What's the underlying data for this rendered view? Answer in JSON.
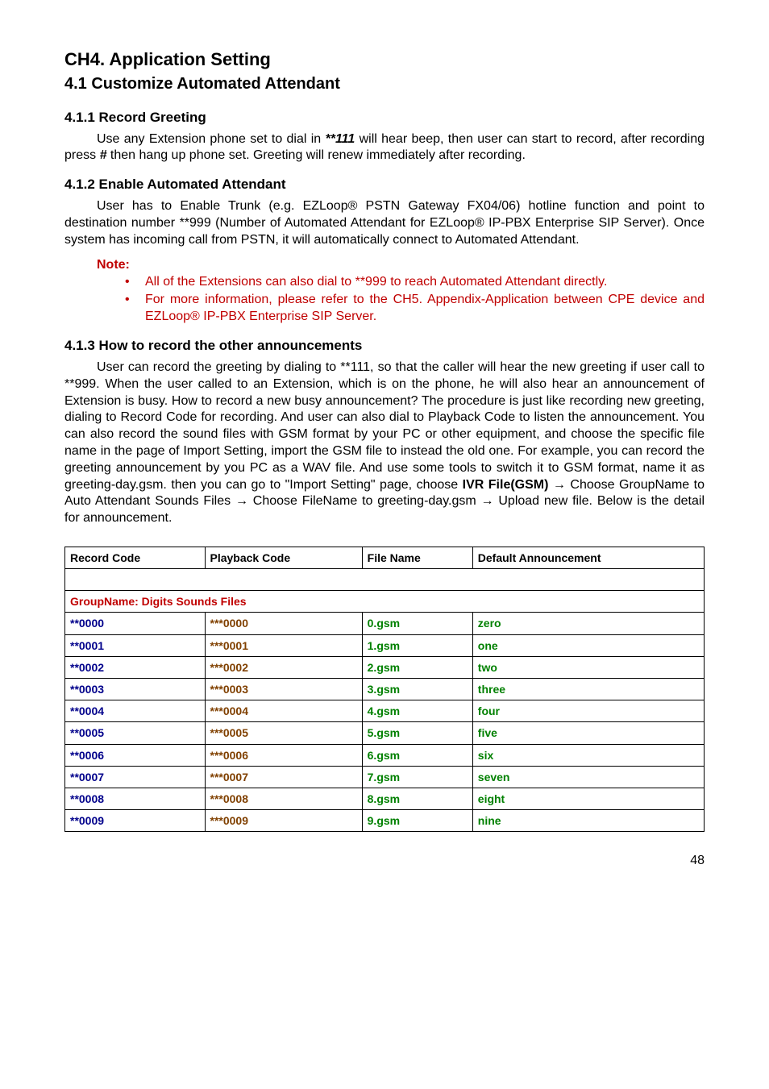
{
  "chapter_title": "CH4. Application Setting",
  "section_title": "4.1 Customize Automated Attendant",
  "s411": {
    "heading": "4.1.1 Record Greeting",
    "p1a": "Use any Extension phone set to dial in ",
    "code1": "**111",
    "p1b": " will hear beep, then user can start to record, after recording press ",
    "code2": "#",
    "p1c": " then hang up phone set. Greeting will renew immediately after recording."
  },
  "s412": {
    "heading": "4.1.2 Enable Automated Attendant",
    "p1": "User has to Enable Trunk (e.g. EZLoop® PSTN Gateway FX04/06) hotline function and point to destination number **999 (Number of Automated Attendant for EZLoop® IP-PBX Enterprise SIP Server). Once system has incoming call from PSTN, it will automatically connect to Automated Attendant.",
    "note_label": "Note:",
    "notes": [
      "All of the Extensions can also dial to **999 to reach Automated Attendant directly.",
      "For more information, please refer to the CH5. Appendix-Application between CPE device and EZLoop® IP-PBX Enterprise SIP Server."
    ]
  },
  "s413": {
    "heading": "4.1.3 How to record the other announcements",
    "p1a": "User can record the greeting by dialing to **111, so that the caller will hear the new greeting if user call to **999. When the user called to an Extension, which is on the phone, he will also hear an announcement of Extension is busy. How to record a new busy announcement? The procedure is just like recording new greeting, dialing to Record Code for recording. And user can also dial to Playback Code to listen the announcement. You can also record the sound files with GSM format by your PC or other equipment, and choose the specific file name in the page of Import Setting, import the GSM file to instead the old one. For example, you can record the greeting announcement by you PC as a WAV file. And use some tools to switch it to GSM format, name it as greeting-day.gsm. then you can go to \"Import Setting\" page, choose ",
    "ivr": "IVR File(GSM) →",
    "p1b": " Choose GroupName to Auto Attendant Sounds Files → Choose FileName to greeting-day.gsm → Upload new file. Below is the detail for announcement."
  },
  "table": {
    "group_name": "GroupName: Digits Sounds Files",
    "headers": {
      "record": "Record Code",
      "playback": "Playback Code",
      "filename": "File Name",
      "announcement": "Default Announcement"
    },
    "rows": [
      {
        "rec": "**0000",
        "pb": "***0000",
        "fn": "0.gsm",
        "ann": "zero"
      },
      {
        "rec": "**0001",
        "pb": "***0001",
        "fn": "1.gsm",
        "ann": "one"
      },
      {
        "rec": "**0002",
        "pb": "***0002",
        "fn": "2.gsm",
        "ann": "two"
      },
      {
        "rec": "**0003",
        "pb": "***0003",
        "fn": "3.gsm",
        "ann": "three"
      },
      {
        "rec": "**0004",
        "pb": "***0004",
        "fn": "4.gsm",
        "ann": "four"
      },
      {
        "rec": "**0005",
        "pb": "***0005",
        "fn": "5.gsm",
        "ann": "five"
      },
      {
        "rec": "**0006",
        "pb": "***0006",
        "fn": "6.gsm",
        "ann": "six"
      },
      {
        "rec": "**0007",
        "pb": "***0007",
        "fn": "7.gsm",
        "ann": "seven"
      },
      {
        "rec": "**0008",
        "pb": "***0008",
        "fn": "8.gsm",
        "ann": "eight"
      },
      {
        "rec": "**0009",
        "pb": "***0009",
        "fn": "9.gsm",
        "ann": "nine"
      }
    ]
  },
  "page_number": "48"
}
